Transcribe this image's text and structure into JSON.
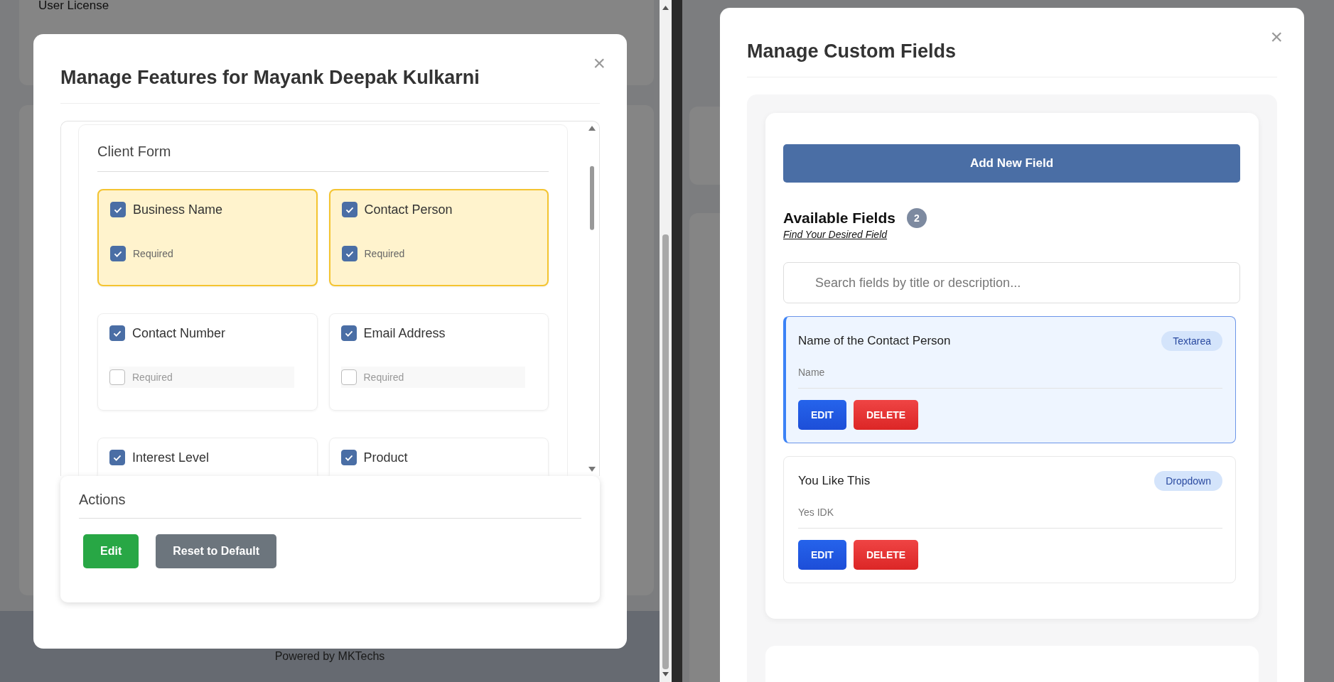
{
  "background": {
    "section_label": "User License",
    "footer": "Powered by MKTechs"
  },
  "features_modal": {
    "title": "Manage Features for Mayank Deepak Kulkarni",
    "close": "×",
    "section": "Client Form",
    "fields": [
      {
        "label": "Business Name",
        "checked": true,
        "required": {
          "label": "Required",
          "checked": true
        }
      },
      {
        "label": "Contact Person",
        "checked": true,
        "required": {
          "label": "Required",
          "checked": true
        }
      },
      {
        "label": "Contact Number",
        "checked": true,
        "required": {
          "label": "Required",
          "checked": false
        }
      },
      {
        "label": "Email Address",
        "checked": true,
        "required": {
          "label": "Required",
          "checked": false
        }
      },
      {
        "label": "Interest Level",
        "checked": true
      },
      {
        "label": "Product",
        "checked": true
      }
    ],
    "actions": {
      "title": "Actions",
      "buttons": [
        {
          "label": "Edit",
          "kind": "primary"
        },
        {
          "label": "Reset to Default",
          "kind": "secondary"
        }
      ]
    }
  },
  "custom_fields_modal": {
    "title": "Manage Custom Fields",
    "close": "×",
    "add_button": "Add New Field",
    "available": {
      "title": "Available Fields",
      "count": "2",
      "link": "Find Your Desired Field"
    },
    "search": {
      "placeholder": "Search fields by title or description..."
    },
    "fields": [
      {
        "title": "Name of the Contact Person",
        "type": "Textarea",
        "description": "Name",
        "selected": true,
        "buttons": [
          {
            "label": "EDIT",
            "kind": "edit"
          },
          {
            "label": "DELETE",
            "kind": "delete"
          }
        ]
      },
      {
        "title": "You Like This",
        "type": "Dropdown",
        "description": "Yes IDK",
        "selected": false,
        "buttons": [
          {
            "label": "EDIT",
            "kind": "edit"
          },
          {
            "label": "DELETE",
            "kind": "delete"
          }
        ]
      }
    ]
  }
}
